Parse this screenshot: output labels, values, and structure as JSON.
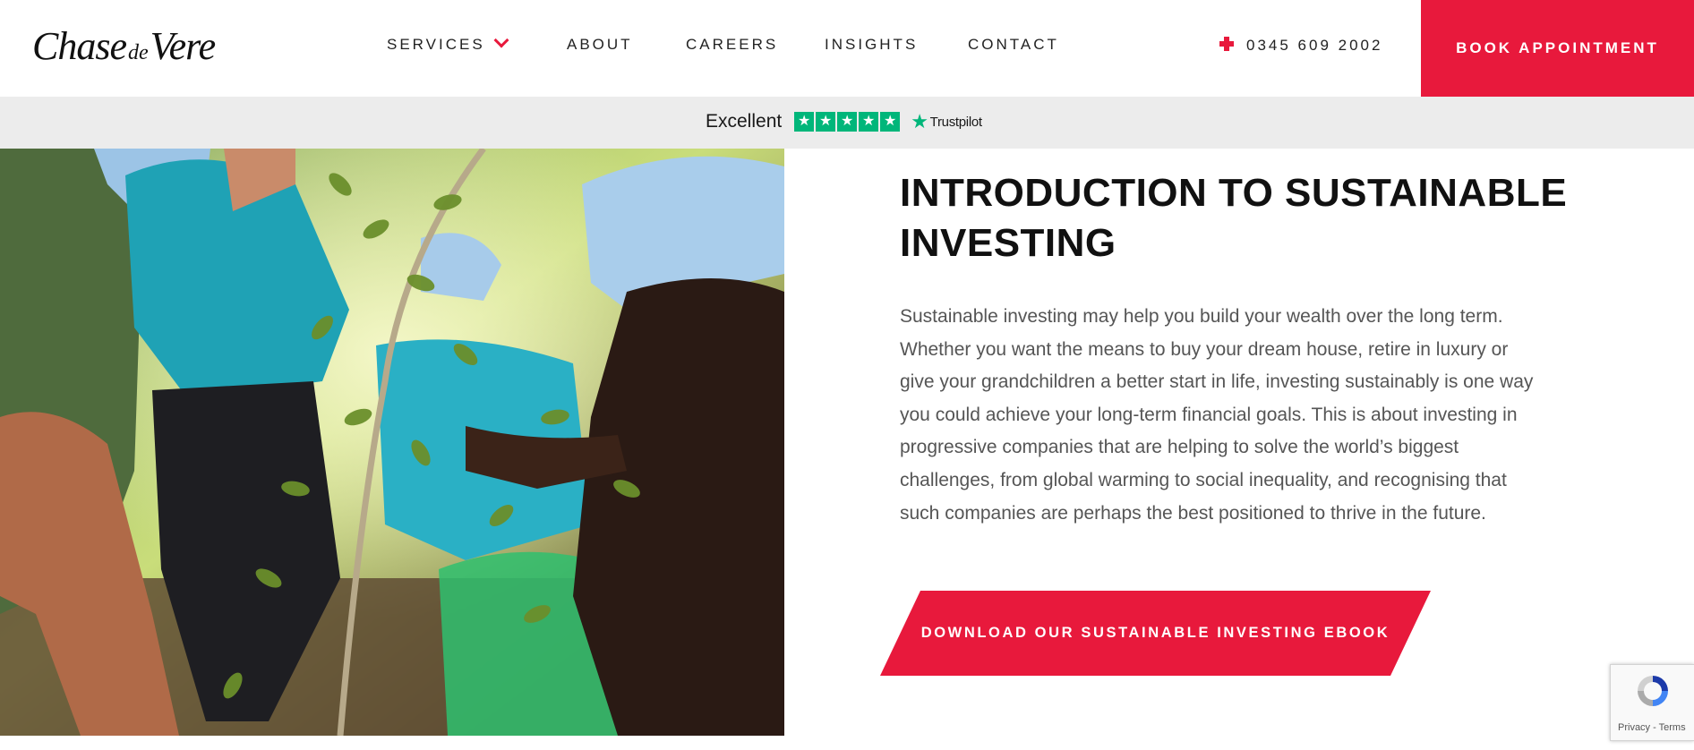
{
  "header": {
    "logo": {
      "part1": "Chase",
      "part2": "de",
      "part3": "Vere"
    },
    "nav": [
      {
        "label": "SERVICES",
        "has_dropdown": true
      },
      {
        "label": "ABOUT"
      },
      {
        "label": "CAREERS"
      },
      {
        "label": "INSIGHTS"
      },
      {
        "label": "CONTACT"
      }
    ],
    "phone": "0345 609 2002",
    "book_label": "BOOK APPOINTMENT"
  },
  "trustpilot": {
    "rating_text": "Excellent",
    "stars": 5,
    "brand": "Trustpilot"
  },
  "main": {
    "title": "INTRODUCTION TO SUSTAINABLE INVESTING",
    "body": "Sustainable investing may help you build your wealth over the long term. Whether you want the means to buy your dream house, retire in luxury or give your grandchildren a better start in life, investing sustainably is one way you could achieve your long-term financial goals. This is about investing in progressive companies that are helping to solve the world’s biggest challenges, from global warming to social inequality, and recognising that such companies are perhaps the best positioned to thrive in the future.",
    "cta_label": "DOWNLOAD OUR SUSTAINABLE INVESTING EBOOK"
  },
  "recaptcha": {
    "links": "Privacy - Terms"
  },
  "colors": {
    "accent": "#e8193c",
    "trustpilot_green": "#00b67a",
    "trustbar_bg": "#ececec",
    "body_text": "#555555"
  }
}
